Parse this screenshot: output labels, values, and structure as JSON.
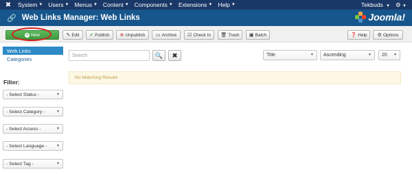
{
  "topbar": {
    "menu": [
      {
        "label": "System"
      },
      {
        "label": "Users"
      },
      {
        "label": "Menus"
      },
      {
        "label": "Content"
      },
      {
        "label": "Components"
      },
      {
        "label": "Extensions"
      },
      {
        "label": "Help"
      }
    ],
    "user": "Tekbuds"
  },
  "header": {
    "title": "Web Links Manager: Web Links",
    "logo_text": "Joomla!"
  },
  "toolbar": {
    "new_label": "New",
    "edit_label": "Edit",
    "publish_label": "Publish",
    "unpublish_label": "Unpublish",
    "archive_label": "Archive",
    "checkin_label": "Check In",
    "trash_label": "Trash",
    "batch_label": "Batch",
    "help_label": "Help",
    "options_label": "Options"
  },
  "sidebar": {
    "items": [
      {
        "label": "Web Links"
      },
      {
        "label": "Categories"
      }
    ],
    "filter_label": "Filter:",
    "filters": [
      {
        "label": "- Select Status -"
      },
      {
        "label": "- Select Category -"
      },
      {
        "label": "- Select Access -"
      },
      {
        "label": "- Select Language -"
      },
      {
        "label": "- Select Tag -"
      }
    ]
  },
  "main": {
    "search_placeholder": "Search",
    "sort_field": "Title",
    "sort_order": "Ascending",
    "limit": "20",
    "alert": "No Matching Results"
  },
  "colors": {
    "topbar": "#1a3867",
    "header": "#17568c",
    "new_button": "#46a546",
    "active_item": "#2d8ac7",
    "highlight": "#d62020"
  }
}
